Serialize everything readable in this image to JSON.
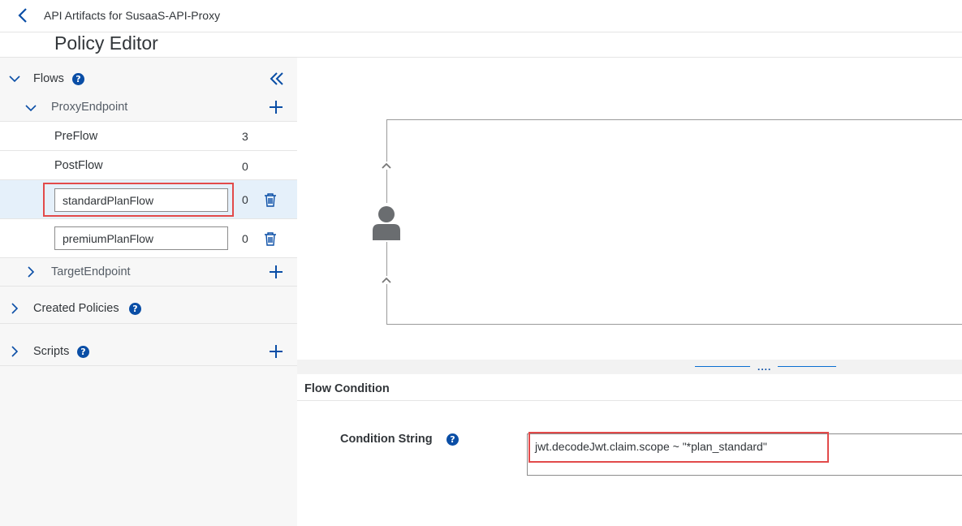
{
  "header": {
    "breadcrumb_title": "API Artifacts for SusaaS-API-Proxy",
    "page_title": "Policy Editor"
  },
  "sidebar": {
    "flows_label": "Flows",
    "proxy_endpoint_label": "ProxyEndpoint",
    "flows": [
      {
        "name": "PreFlow",
        "count": "3"
      },
      {
        "name": "PostFlow",
        "count": "0"
      },
      {
        "name": "standardPlanFlow",
        "count": "0"
      },
      {
        "name": "premiumPlanFlow",
        "count": "0"
      }
    ],
    "target_endpoint_label": "TargetEndpoint",
    "created_policies_label": "Created Policies",
    "scripts_label": "Scripts",
    "help_glyph": "?"
  },
  "splitter": {
    "handle": "...."
  },
  "flow_condition": {
    "title": "Flow Condition",
    "condition_label": "Condition String",
    "condition_value": "jwt.decodeJwt.claim.scope ~ \"*plan_standard\""
  },
  "colors": {
    "accent": "#0a6ed1",
    "icon_blue": "#0a4ea6",
    "selected_row": "#e5f0fa",
    "highlight_box": "#e24a4a"
  },
  "icons": [
    "back-arrow-icon",
    "collapse-double-chevron-icon",
    "chevron-down-icon",
    "chevron-right-icon",
    "help-icon",
    "plus-icon",
    "trash-icon",
    "person-icon",
    "up-arrow-icon"
  ]
}
